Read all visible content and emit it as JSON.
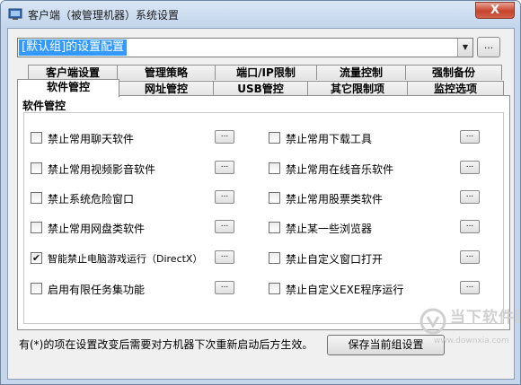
{
  "window": {
    "title": "客户端（被管理机器）系统设置",
    "close_label": "X"
  },
  "config_select": {
    "value": "[默认组]的设置配置",
    "more_label": "..."
  },
  "tabs_row1": [
    {
      "label": "客户端设置"
    },
    {
      "label": "管理策略"
    },
    {
      "label": "端口/IP限制"
    },
    {
      "label": "流量控制"
    },
    {
      "label": "强制备份"
    }
  ],
  "tabs_row2": [
    {
      "label": "软件管控",
      "active": true
    },
    {
      "label": "网址管控"
    },
    {
      "label": "USB管控"
    },
    {
      "label": "其它限制项"
    },
    {
      "label": "监控选项"
    }
  ],
  "group": {
    "title": "软件管控"
  },
  "options_left": [
    {
      "label": "禁止常用聊天软件",
      "checked": false,
      "btn": "..."
    },
    {
      "label": "禁止常用视频影音软件",
      "checked": false,
      "btn": "..."
    },
    {
      "label": "禁止系统危险窗口",
      "checked": false,
      "btn": "..."
    },
    {
      "label": "禁止常用网盘类软件",
      "checked": false,
      "btn": "..."
    },
    {
      "label": "智能禁止电脑游戏运行（DirectX）",
      "checked": true,
      "btn": "..."
    },
    {
      "label": "启用有限任务集功能",
      "checked": false,
      "btn": "..."
    }
  ],
  "options_right": [
    {
      "label": "禁止常用下载工具",
      "checked": false,
      "btn": "..."
    },
    {
      "label": "禁止常用在线音乐软件",
      "checked": false,
      "btn": "..."
    },
    {
      "label": "禁止常用股票类软件",
      "checked": false,
      "btn": "..."
    },
    {
      "label": "禁止某一些浏览器",
      "checked": false,
      "btn": "..."
    },
    {
      "label": "禁止自定义窗口打开",
      "checked": false,
      "btn": "..."
    },
    {
      "label": "禁止自定义EXE程序运行",
      "checked": false,
      "btn": "..."
    }
  ],
  "footer": {
    "hint": "有(*)的项在设置改变后需要对方机器下次重新启动后方生效。",
    "save_label": "保存当前组设置"
  },
  "watermark": {
    "text": "当下软件园",
    "url": "www.downxia.com"
  }
}
